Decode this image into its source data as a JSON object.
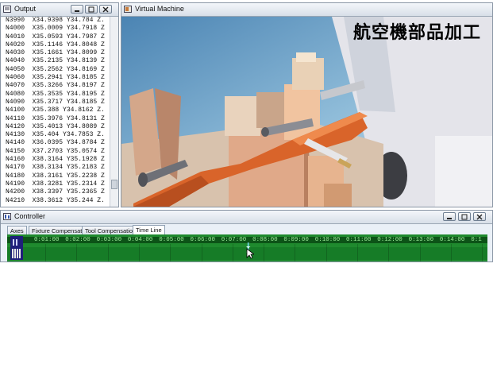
{
  "output": {
    "title": "Output",
    "lines": [
      "N3990  X34.9398 Y34.784 Z.",
      "N4000  X35.0009 Y34.7918 Z",
      "N4010  X35.0593 Y34.7987 Z",
      "N4020  X35.1146 Y34.8048 Z",
      "N4030  X35.1661 Y34.8099 Z",
      "N4040  X35.2135 Y34.8139 Z",
      "N4050  X35.2562 Y34.8169 Z",
      "N4060  X35.2941 Y34.8185 Z",
      "N4070  X35.3266 Y34.8197 Z",
      "N4080  X35.3535 Y34.8195 Z",
      "N4090  X35.3717 Y34.8185 Z",
      "N4100  X35.388 Y34.8162 Z.",
      "N4110  X35.3976 Y34.8131 Z",
      "N4120  X35.4013 Y34.8089 Z",
      "N4130  X35.404 Y34.7853 Z.",
      "N4140  X36.0395 Y34.8784 Z",
      "N4150  X37.2703 Y35.0574 Z",
      "N4160  X38.3164 Y35.1928 Z",
      "N4170  X38.3134 Y35.2183 Z",
      "N4180  X38.3161 Y35.2238 Z",
      "N4190  X38.3281 Y35.2314 Z",
      "N4200  X38.3397 Y35.2365 Z",
      "N4210  X38.3612 Y35.244 Z."
    ]
  },
  "virtual_machine": {
    "title": "Virtual Machine",
    "overlay_title": "航空機部品加工"
  },
  "controller": {
    "title": "Controller",
    "tabs": [
      {
        "label": "Axes",
        "active": false
      },
      {
        "label": "Fixture Compensation",
        "active": false
      },
      {
        "label": "Tool Compensation",
        "active": false
      },
      {
        "label": "Time Line",
        "active": true
      }
    ],
    "timeline": {
      "ticks": [
        "0:01:00",
        "0:02:00",
        "0:03:00",
        "0:04:00",
        "0:05:00",
        "0:06:00",
        "0:07:00",
        "0:08:00",
        "0:09:00",
        "0:10:00",
        "0:11:00",
        "0:12:00",
        "0:13:00",
        "0:14:00",
        "0:1"
      ],
      "playhead_fraction": 0.502
    }
  },
  "colors": {
    "timeline_bg": "#1f8a2e",
    "part_orange": "#d9642a",
    "accent_blue": "#1f1f7a"
  }
}
